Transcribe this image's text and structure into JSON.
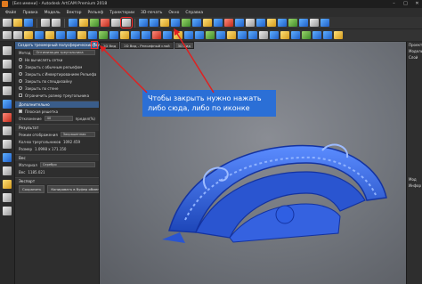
{
  "window": {
    "title": "[Без имени] - Autodesk ArtCAM Premium 2018"
  },
  "window_controls": {
    "minimize": "–",
    "maximize": "□",
    "close": "✕"
  },
  "menu": [
    "Файл",
    "Правка",
    "Модель",
    "Вектор",
    "Рельеф",
    "Траектории",
    "3D-печать",
    "Окно",
    "Справка"
  ],
  "left_panel": {
    "header": "Создать трехмерный полусферический рельеф.",
    "close_label": "✕",
    "mode_label": "Метод",
    "mode_value": "Оптимизация треугольника",
    "options": [
      "Не вычислять сетки",
      "Закрыть с обычным рельефом",
      "Закрыть с Инвертированием Рельефа",
      "Закрыть по спецдизайну",
      "Закрыть по стене"
    ],
    "limit_check": "Ограничить размер треугольника",
    "section_additional": "Дополнительно",
    "checkbox_flat": "Плоская решетка",
    "tolerance_label": "Отклонение",
    "tolerance_value": "40",
    "angle_label": "предел(%)",
    "section_result": "Результат",
    "model_mode_label": "Режим отображения",
    "model_mode_value": "Закрашенная",
    "tris_label": "Кол-во треугольников",
    "tris_value": "1092 459",
    "size_label": "Размер",
    "size_value": "1.0998 x 171.150",
    "section_weight": "Вес",
    "material_label": "Материал",
    "material_value": "Серебро",
    "weight_label": "Вес",
    "weight_value": "1185.021",
    "section_export": "Экспорт",
    "save_button": "Сохранить",
    "copy_button": "Копировать в буфер обмена"
  },
  "viewport": {
    "tabs": [
      "2D Вид",
      "2D Вид - Рельефный слой",
      "3D Вид"
    ],
    "callout_text": "Чтобы закрыть нужно нажать либо сюда, либо по иконке"
  },
  "right_panel": {
    "lines": [
      "Проект",
      "Модель",
      "Слой",
      "Мод",
      "Инфор"
    ]
  },
  "colors": {
    "accent": "#2b6fd6",
    "arrow": "#e02020",
    "relief": "#2f66e0"
  }
}
